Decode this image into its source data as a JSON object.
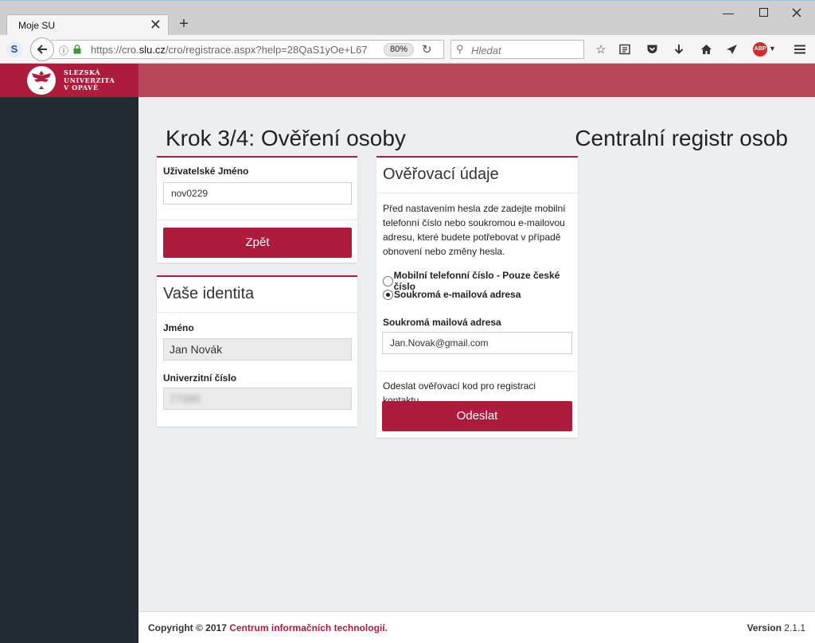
{
  "browser": {
    "tab_title": "Moje SU",
    "tab_close": "✕",
    "new_tab": "+",
    "url_prefix": "https://cro.",
    "url_domain": "slu.cz",
    "url_rest": "/cro/registrace.aspx?help=28QaS1yOe+L67",
    "zoom": "80%",
    "search_placeholder": "Hledat",
    "abp_label": "ABP"
  },
  "brand": {
    "line1": "SLEZSKÁ",
    "line2": "UNIVERZITA",
    "line3": "V OPAVĚ",
    "primary_color": "#ad1c3d",
    "bar_color": "#b8475a",
    "sidebar_color": "#222b31"
  },
  "page": {
    "title": "Krok 3/4: Ověření osoby",
    "app_title": "Centralní registr osob"
  },
  "login_panel": {
    "username_label": "Uživatelské Jméno",
    "username_value": "nov0229",
    "back_button": "Zpět"
  },
  "identity_panel": {
    "heading": "Vaše identita",
    "name_label": "Jméno",
    "name_value": "Jan Novák",
    "uni_number_label": "Univerzitní číslo",
    "uni_number_value": "77390"
  },
  "verify_panel": {
    "heading": "Ověřovací údaje",
    "description": "Před nastavením hesla zde zadejte mobilní telefonní číslo nebo soukromou e-mailovou adresu, které budete potřebovat v případě obnovení nebo změny hesla.",
    "option_phone": "Mobilní telefonní číslo - Pouze české číslo",
    "option_email": "Soukromá e-mailová adresa",
    "selected_option": "email",
    "email_label": "Soukromá mailová adresa",
    "email_value": "Jan.Novak@gmail.com",
    "send_hint": "Odeslat ověřovací kod pro registraci kontaktu.",
    "send_button": "Odeslat"
  },
  "footer": {
    "copyright_prefix": "Copyright © 2017",
    "copyright_link": "Centrum informačních technologií.",
    "version_label": "Version",
    "version_value": "2.1.1"
  }
}
